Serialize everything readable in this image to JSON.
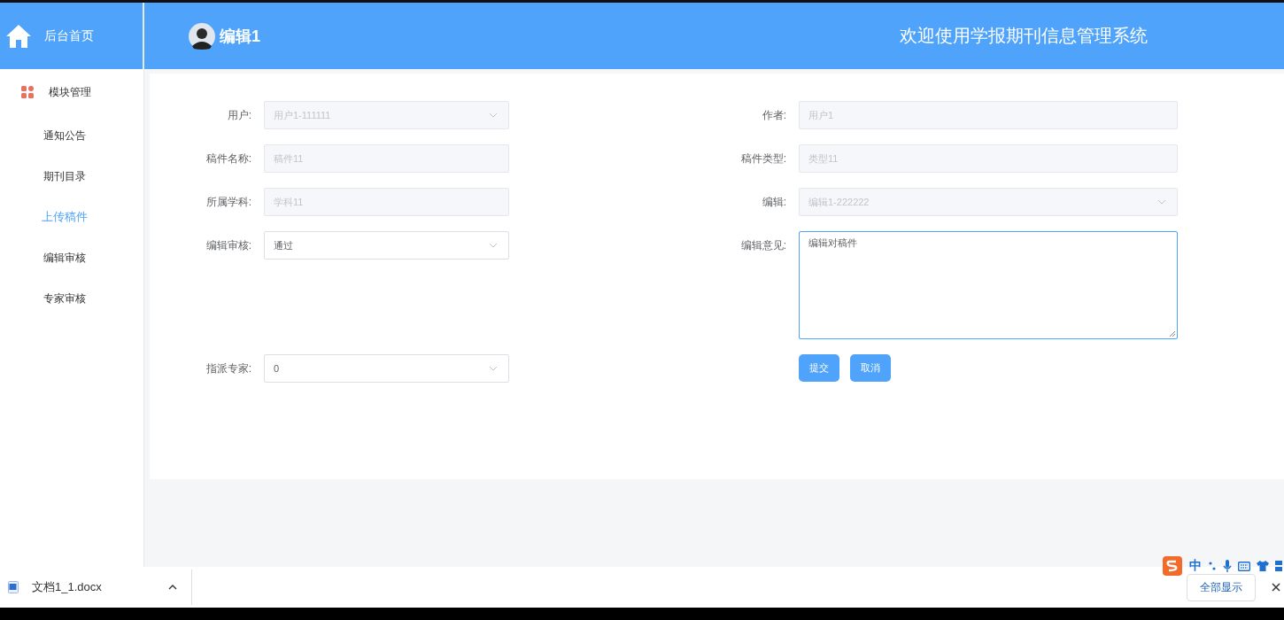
{
  "sidebar": {
    "home": "后台首页",
    "menu": [
      {
        "label": "模块管理",
        "children": [
          {
            "label": "通知公告",
            "selected": false
          },
          {
            "label": "期刊目录",
            "selected": false
          },
          {
            "label": "上传稿件",
            "selected": true
          },
          {
            "label": "编辑审核",
            "selected": false
          },
          {
            "label": "专家审核",
            "selected": false
          }
        ]
      }
    ]
  },
  "header": {
    "user": "编辑1",
    "title": "欢迎使用学报期刊信息管理系统"
  },
  "form": {
    "left": [
      {
        "label": "用户:",
        "kind": "select",
        "value": "用户1-111111",
        "disabled": true
      },
      {
        "label": "稿件名称:",
        "kind": "input",
        "value": "稿件11",
        "disabled": true
      },
      {
        "label": "所属学科:",
        "kind": "input",
        "value": "学科11",
        "disabled": true
      },
      {
        "label": "编辑审核:",
        "kind": "select",
        "value": "通过",
        "disabled": false
      },
      {
        "label": "指派专家:",
        "kind": "select",
        "value": "0",
        "disabled": false
      }
    ],
    "right": [
      {
        "label": "作者:",
        "kind": "input",
        "value": "用户1",
        "disabled": true
      },
      {
        "label": "稿件类型:",
        "kind": "input",
        "value": "类型11",
        "disabled": true
      },
      {
        "label": "编辑:",
        "kind": "select",
        "value": "编辑1-222222",
        "disabled": true
      },
      {
        "label": "编辑意见:",
        "kind": "textarea",
        "value": "编辑对稿件",
        "disabled": false,
        "focused": true
      }
    ],
    "buttons": [
      "提交",
      "取消"
    ]
  },
  "download_bar": {
    "file": "文档1_1.docx",
    "show_all": "全部显示"
  },
  "ime_bar": {
    "mode": "中"
  }
}
